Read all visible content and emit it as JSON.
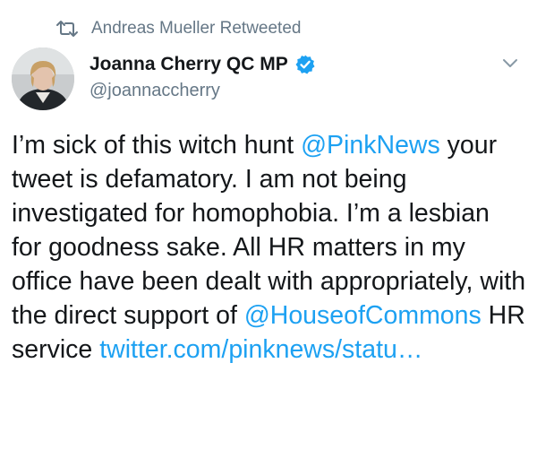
{
  "retweet": {
    "icon": "retweet-icon",
    "label": "Andreas Mueller Retweeted"
  },
  "author": {
    "name": "Joanna Cherry QC MP",
    "handle": "@joannaccherry",
    "verified_icon": "verified-badge-icon",
    "avatar": "avatar"
  },
  "menu": {
    "icon": "chevron-down-icon"
  },
  "tweet": {
    "t1": "I’m sick of this witch hunt ",
    "mention1": "@PinkNews",
    "t2": " your tweet is defamatory. I am not being investigated for homophobia. I’m a lesbian for goodness sake. All HR matters in my office have been dealt with appropriately, with the direct support of ",
    "mention2": "@HouseofCommons",
    "t3": " HR service ",
    "link": "twitter.com/pinknews/statu…"
  },
  "colors": {
    "link": "#1da1f2",
    "muted": "#657786",
    "text": "#14171a",
    "verified": "#1da1f2"
  }
}
